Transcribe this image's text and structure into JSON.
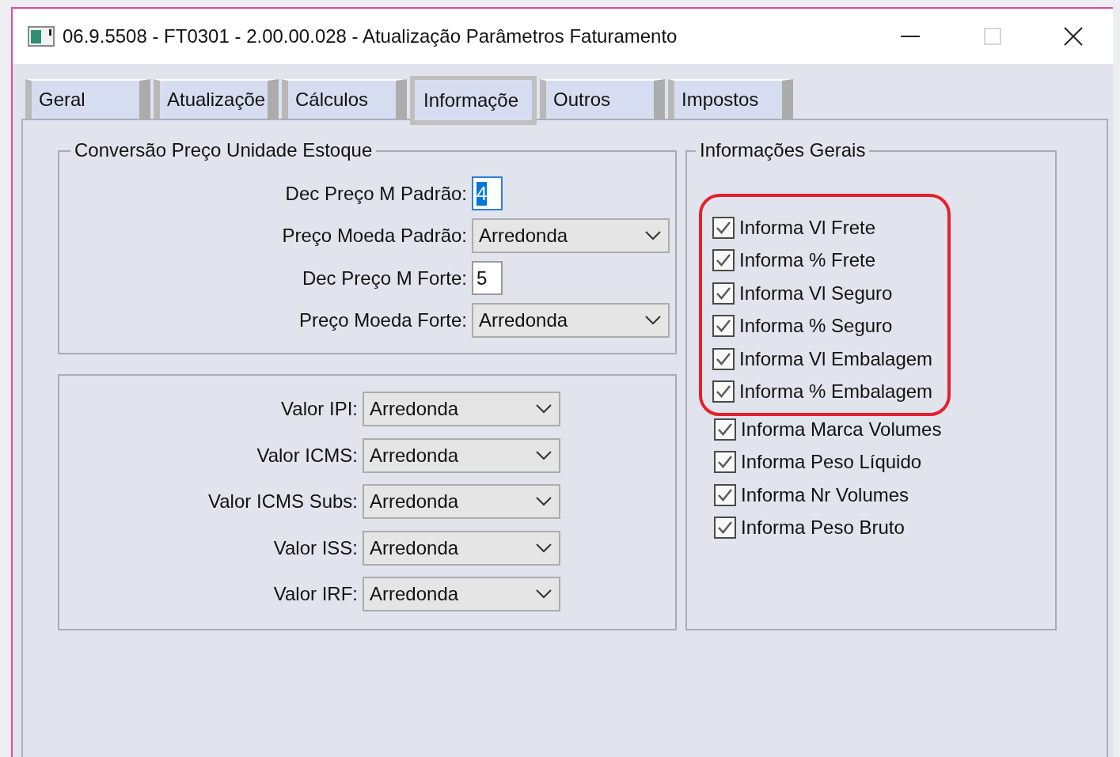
{
  "window": {
    "title": "06.9.5508 - FT0301 - 2.00.00.028 - Atualização Parâmetros Faturamento",
    "controls": [
      {
        "kind": "minimize",
        "disabled": false
      },
      {
        "kind": "maximize",
        "disabled": true
      },
      {
        "kind": "close",
        "disabled": false
      }
    ]
  },
  "tabs": [
    {
      "label": "Geral",
      "selected": false
    },
    {
      "label": "Atualizaçõe",
      "selected": false
    },
    {
      "label": "Cálculos",
      "selected": false
    },
    {
      "label": "Informaçõe",
      "selected": true
    },
    {
      "label": "Outros",
      "selected": false
    },
    {
      "label": "Impostos",
      "selected": false
    }
  ],
  "conversion_group": {
    "title": "Conversão Preço Unidade Estoque",
    "fields": [
      {
        "kind": "number",
        "label": "Dec Preço M Padrão:",
        "value": "4",
        "focused": true
      },
      {
        "kind": "select",
        "label": "Preço Moeda Padrão:",
        "value": "Arredonda",
        "focused": false
      },
      {
        "kind": "number",
        "label": "Dec Preço M Forte:",
        "value": "5",
        "focused": false
      },
      {
        "kind": "select",
        "label": "Preço Moeda Forte:",
        "value": "Arredonda",
        "focused": false
      }
    ]
  },
  "rounding_group": {
    "fields": [
      {
        "kind": "select",
        "label": "Valor IPI:",
        "value": "Arredonda",
        "focused": false
      },
      {
        "kind": "select",
        "label": "Valor ICMS:",
        "value": "Arredonda",
        "focused": false
      },
      {
        "kind": "select",
        "label": "Valor ICMS Subs:",
        "value": "Arredonda",
        "focused": false
      },
      {
        "kind": "select",
        "label": "Valor ISS:",
        "value": "Arredonda",
        "focused": false
      },
      {
        "kind": "select",
        "label": "Valor IRF:",
        "value": "Arredonda",
        "focused": false
      }
    ]
  },
  "general_info_group": {
    "title": "Informações Gerais",
    "highlighted_checkboxes": [
      {
        "label": "Informa Vl Frete",
        "checked": true
      },
      {
        "label": "Informa % Frete",
        "checked": true
      },
      {
        "label": "Informa Vl Seguro",
        "checked": true
      },
      {
        "label": "Informa % Seguro",
        "checked": true
      },
      {
        "label": "Informa Vl Embalagem",
        "checked": true
      },
      {
        "label": "Informa % Embalagem",
        "checked": true
      }
    ],
    "checkboxes": [
      {
        "label": "Informa Marca Volumes",
        "checked": true
      },
      {
        "label": "Informa Peso Líquido",
        "checked": true
      },
      {
        "label": "Informa Nr Volumes",
        "checked": true
      },
      {
        "label": "Informa Peso Bruto",
        "checked": true
      }
    ]
  }
}
